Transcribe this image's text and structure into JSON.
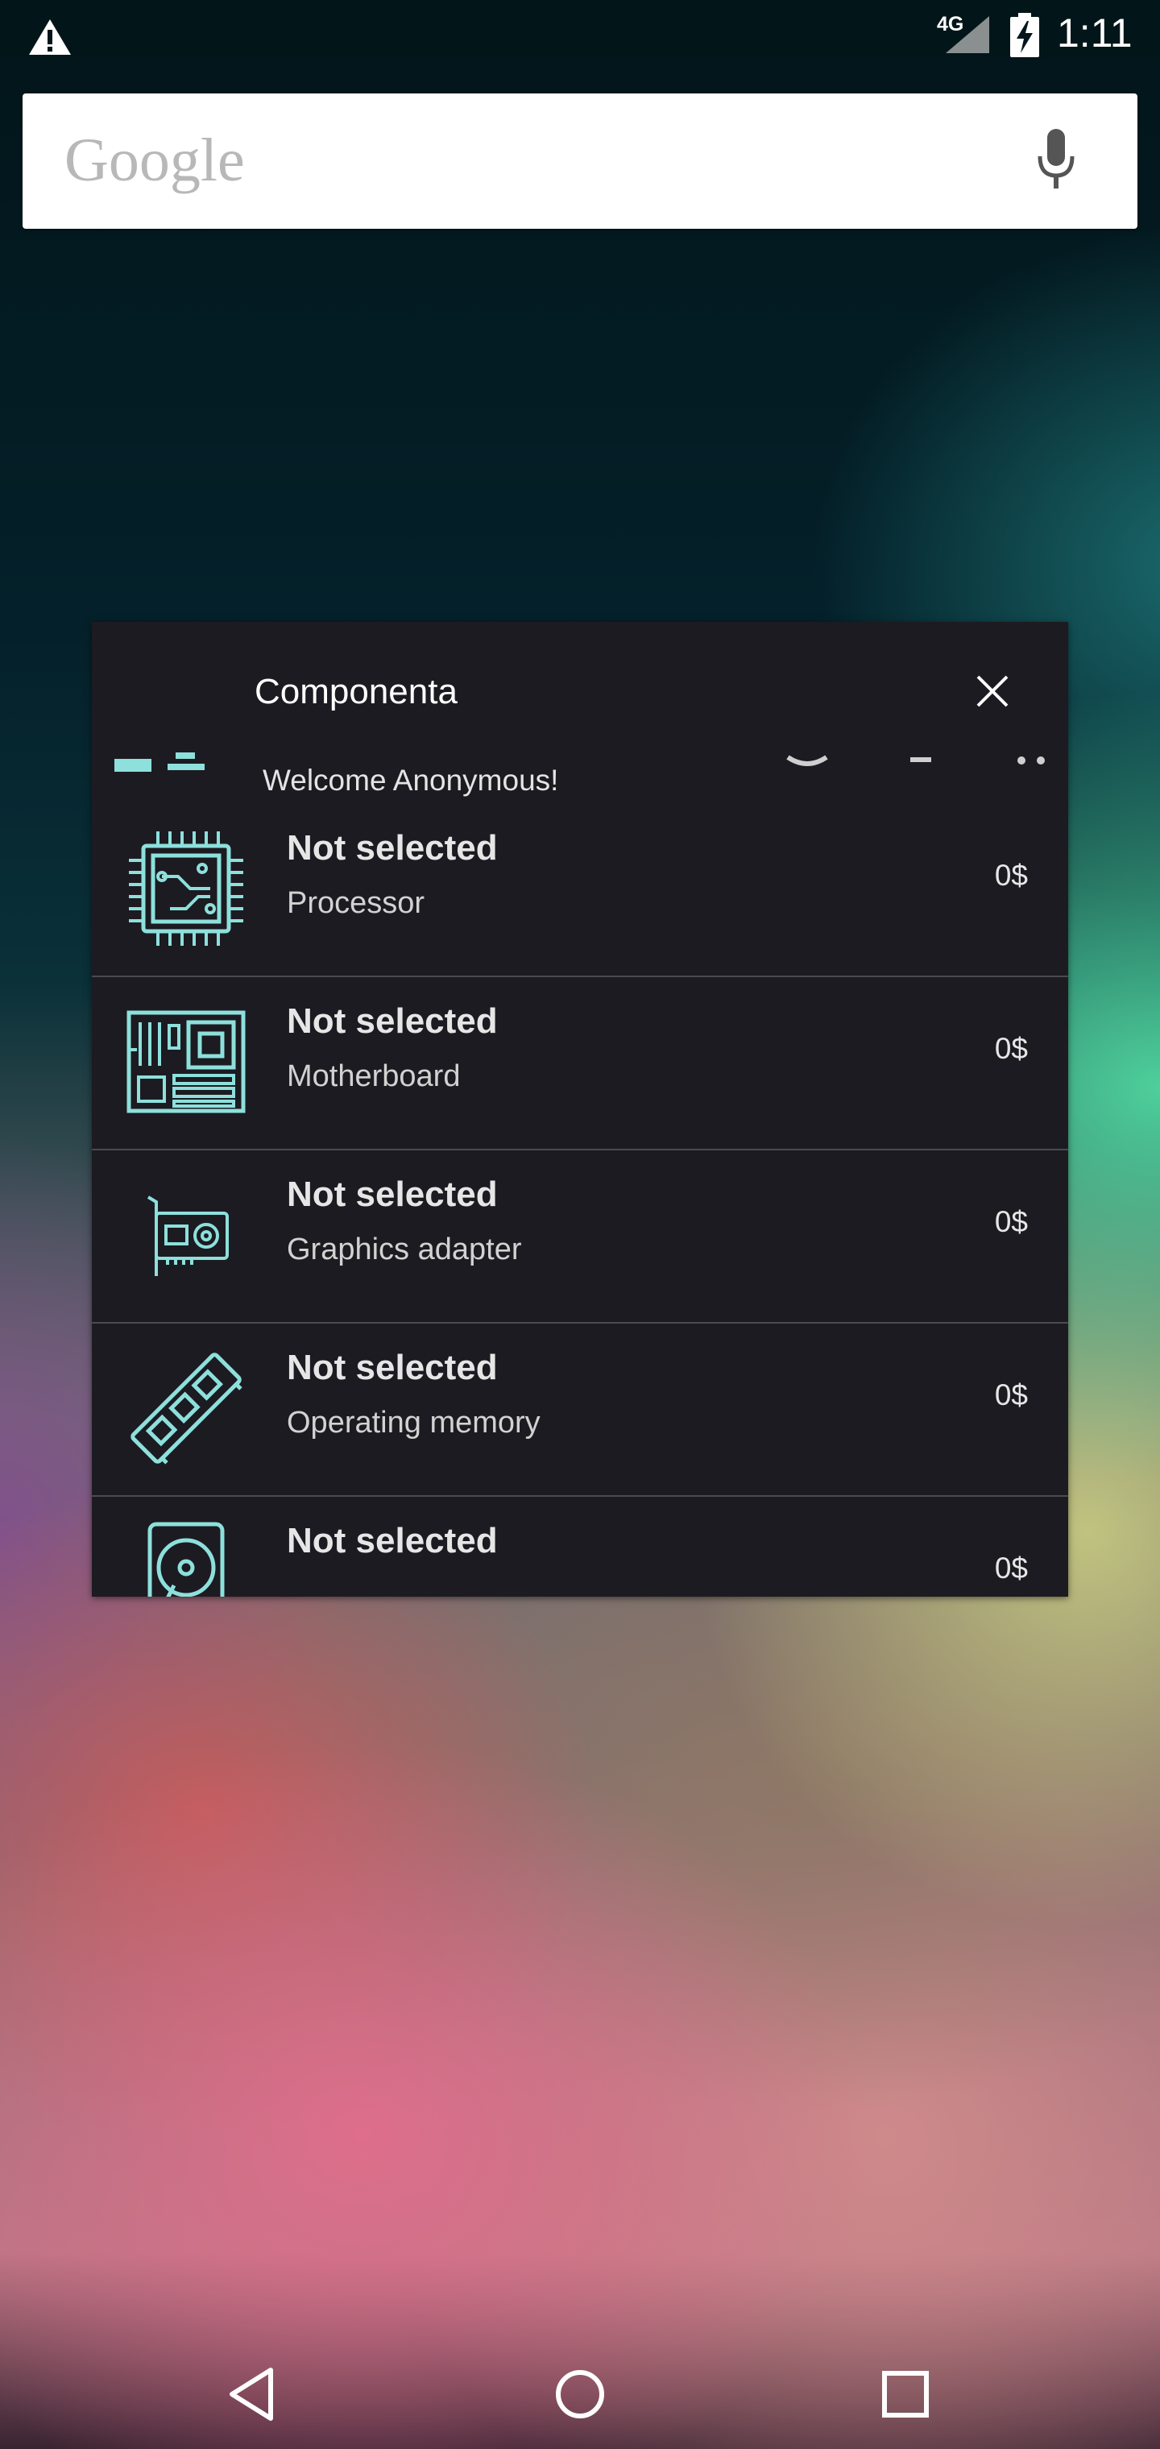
{
  "status_bar": {
    "network": "4G",
    "time": "1:11",
    "icons": [
      "warning-icon",
      "signal-icon",
      "battery-charging-icon"
    ]
  },
  "search": {
    "logo_text": "Google",
    "icon": "mic-icon"
  },
  "widget": {
    "title": "Componenta",
    "welcome": "Welcome  Anonymous!",
    "accent_color": "#8de0dc",
    "items": [
      {
        "title": "Not selected",
        "subtitle": "Processor",
        "price": "0$",
        "icon": "cpu-icon"
      },
      {
        "title": "Not selected",
        "subtitle": "Motherboard",
        "price": "0$",
        "icon": "motherboard-icon"
      },
      {
        "title": "Not selected",
        "subtitle": "Graphics adapter",
        "price": "0$",
        "icon": "graphics-card-icon"
      },
      {
        "title": "Not selected",
        "subtitle": "Operating memory",
        "price": "0$",
        "icon": "ram-icon"
      },
      {
        "title": "Not selected",
        "subtitle": "",
        "price": "0$",
        "icon": "hard-drive-icon"
      }
    ]
  },
  "nav_bar": {
    "icons": [
      "back-icon",
      "home-icon",
      "recents-icon"
    ]
  }
}
